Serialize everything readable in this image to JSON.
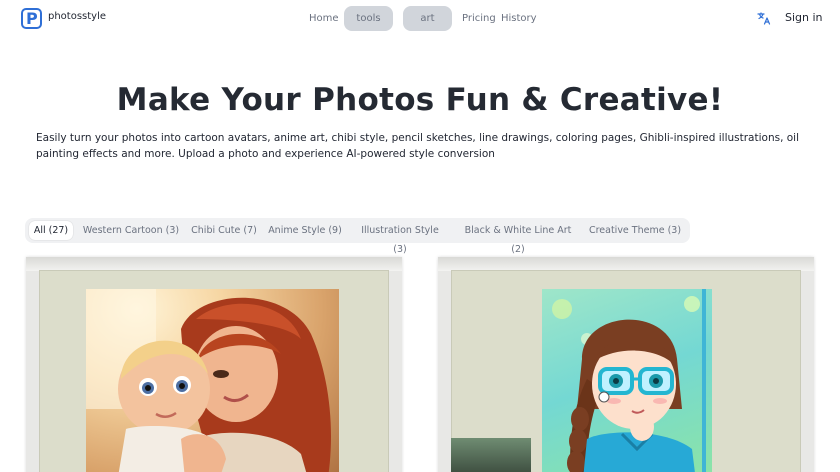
{
  "header": {
    "brand": "photosstyle",
    "nav": {
      "home": "Home",
      "tools": "tools",
      "art": "art",
      "pricing": "Pricing",
      "history": "History"
    },
    "translate_icon": "translate-icon",
    "signin": "Sign in",
    "accent": "#2f6fd6"
  },
  "hero": {
    "title": "Make Your Photos Fun & Creative!",
    "subtitle": "Easily turn your photos into cartoon avatars, anime art, chibi style, pencil sketches, line drawings, coloring pages, Ghibli-inspired illustrations, oil painting effects and more. Upload a photo and experience AI-powered style conversion"
  },
  "filters": {
    "tabs": [
      "All (27)",
      "Western Cartoon (3)",
      "Chibi Cute (7)",
      "Anime Style (9)",
      "Illustration Style (3)",
      "Black & White Line Art (2)",
      "Creative Theme (3)"
    ],
    "active_index": 0
  },
  "gallery": {
    "cards": [
      {
        "image": "cartoon-mother-and-baby-image"
      },
      {
        "image": "anime-girl-with-glasses-image"
      }
    ]
  }
}
